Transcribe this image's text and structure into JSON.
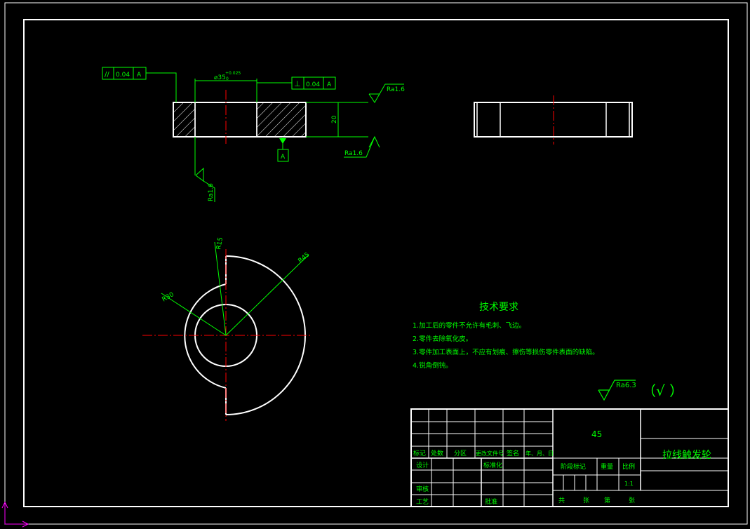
{
  "colors": {
    "background": "#000000",
    "outline": "#ffffff",
    "annotation": "#00ff00",
    "centerline": "#ff0000",
    "ucs": "#ff00ff"
  },
  "top_view": {
    "parallelism": {
      "symbol": "//",
      "value": "0.04",
      "datum": "A"
    },
    "perpendicularity": {
      "symbol": "⊥",
      "value": "0.04",
      "datum": "A"
    },
    "diameter": "⌀35",
    "tolerance_upper": "+0.025",
    "tolerance_lower": "0",
    "height": "20",
    "roughness_top": "Ra1.6",
    "roughness_bottom": "Ra1.6",
    "roughness_left": "Ra1.6",
    "datum_label": "A"
  },
  "front_view": {
    "r_small": "R15",
    "r_mid": "R30",
    "r_large": "R45"
  },
  "tech_req": {
    "title": "技术要求",
    "items": [
      "1.加工后的零件不允许有毛刺、飞边。",
      "2.零件去除氧化皮。",
      "3.零件加工表面上，不应有划痕、擦伤等损伤零件表面的缺陷。",
      "4.锐角倒钝。"
    ]
  },
  "roughness_general": {
    "value": "Ra6.3",
    "other": "（√ ）"
  },
  "title_block": {
    "material": "45",
    "part_name": "拉线触发轮",
    "header_row": [
      "标记",
      "处数",
      "分区",
      "更改文件号",
      "签名",
      "年、月、日"
    ],
    "design": "设计",
    "standardize": "标准化",
    "stage_mark": "阶段标记",
    "weight": "重量",
    "scale": "比例",
    "scale_value": "1:1",
    "review": "审核",
    "process": "工艺",
    "approve": "批准",
    "total": "共",
    "sheet": "张",
    "page_no": "第",
    "sheet2": "张"
  }
}
